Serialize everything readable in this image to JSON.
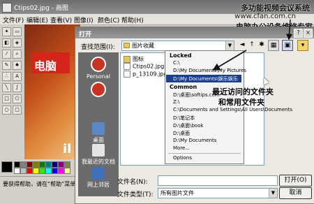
{
  "paint": {
    "title": "Ctips02.jpg - 画图",
    "menu": [
      "文件(F)",
      "编辑(E)",
      "查看(V)",
      "图像(I)",
      "颜色(C)",
      "帮助(H)"
    ],
    "canvas_text": "电脑",
    "canvas_text2": "il",
    "status": "要获得帮助，请在“帮助”菜单中"
  },
  "watermark": {
    "line1": "多功能视频会议系统",
    "url": "www.cfan.com.cn",
    "line3": "电脑办公设备维修专家"
  },
  "dialog": {
    "title": "打开",
    "title_buttons": [
      "?",
      "×"
    ],
    "look_in_label": "查找范围(I):",
    "look_in_value": "图片收藏",
    "places": [
      "Personal",
      "",
      "桌面",
      "我最近的文档",
      "网上邻居"
    ],
    "files": [
      "图标",
      "Ctips02.jpg",
      "p_13109.jpg"
    ],
    "filename_label": "文件名(N):",
    "filename_value": "",
    "filetype_label": "文件类型(T):",
    "filetype_value": "所有图片文件",
    "open_button": "打开(O)",
    "cancel_button": "取消"
  },
  "dropdown": {
    "locked_header": "Locked",
    "locked_items": [
      "C:\\",
      "D:\\My Documents\\My Pictures",
      "D:\\My Documents\\娱乐娱乐"
    ],
    "common_header": "Common",
    "common_items": [
      "D:\\桌面\\softips.com",
      "Z:\\",
      "C:\\Documents and Settings\\All Users\\Documents",
      "D:\\笔记本",
      "D:\\桌面\\book",
      "D:\\桌面",
      "D:\\My Documents",
      "More..."
    ],
    "options": "Options",
    "selected_index": 2
  },
  "callout": {
    "line1": "最近访问的文件夹",
    "line2": "和常用文件夹"
  },
  "colors": {
    "dialog_bg": "#ece9e3",
    "selection": "#1c3f8f",
    "places_bg": "#6b6b6b"
  }
}
